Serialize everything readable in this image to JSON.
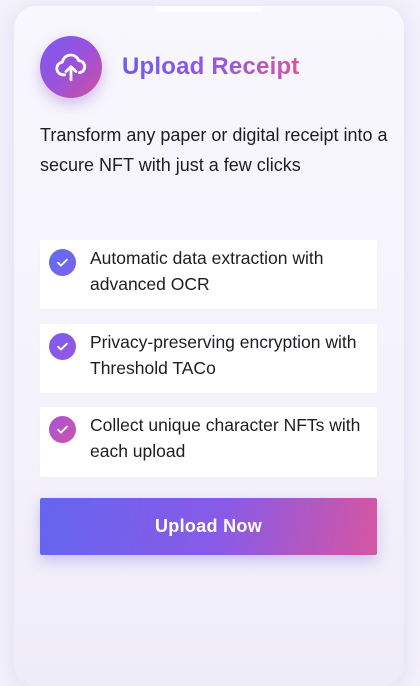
{
  "header": {
    "icon": "cloud-upload-icon",
    "title": "Upload Receipt"
  },
  "description": "Transform any paper or digital receipt into a secure NFT with just a few clicks",
  "features": [
    {
      "icon": "check-circle-icon",
      "text": "Automatic data extraction with advanced OCR"
    },
    {
      "icon": "check-circle-icon",
      "text": "Privacy-preserving encryption with Threshold TACo"
    },
    {
      "icon": "check-circle-icon",
      "text": "Collect unique character NFTs with each upload"
    }
  ],
  "cta": {
    "label": "Upload Now"
  },
  "colors": {
    "gradient_start": "#6465ee",
    "gradient_mid": "#8a5ae6",
    "gradient_end": "#d655a2",
    "text": "#1d1d24",
    "background": "#f3f1fb"
  }
}
